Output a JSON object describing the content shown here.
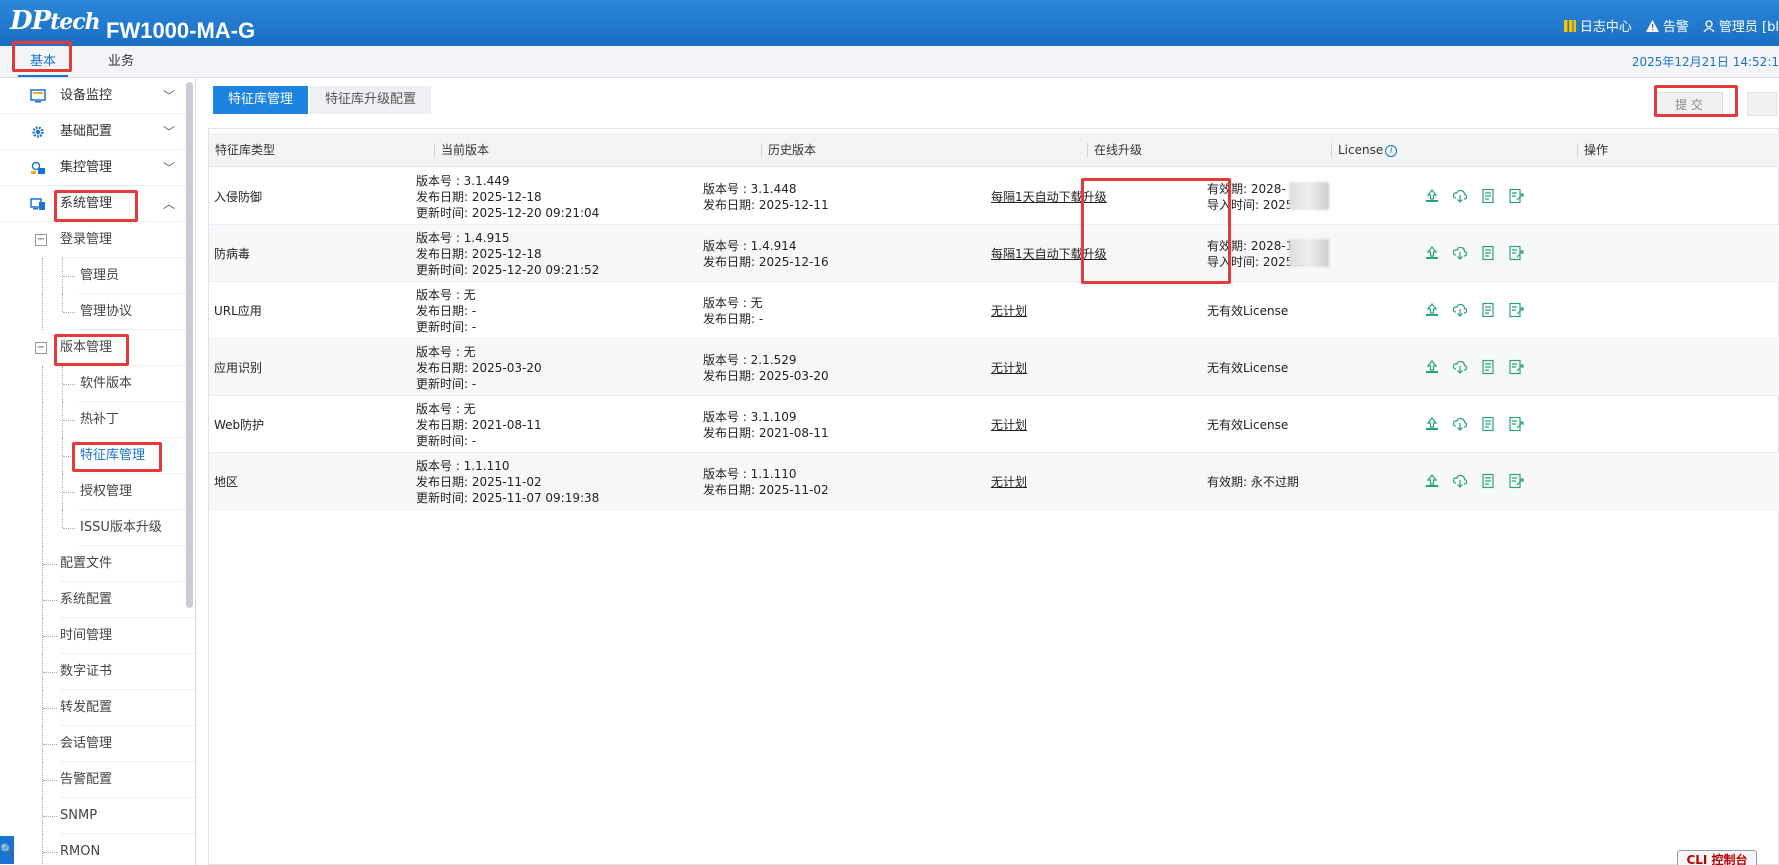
{
  "header": {
    "logo_main": "DP",
    "logo_sub": "tech",
    "model": "FW1000-MA-G",
    "log_center": "日志中心",
    "alarm": "告警",
    "user": "管理员 [bl"
  },
  "nav": {
    "tabs": [
      {
        "label": "基本"
      },
      {
        "label": "业务"
      }
    ],
    "datetime": "2025年12月21日   14:52:1"
  },
  "sidebar": {
    "groups": [
      {
        "label": "设备监控"
      },
      {
        "label": "基础配置"
      },
      {
        "label": "集控管理"
      },
      {
        "label": "系统管理"
      }
    ],
    "login_mgmt": "登录管理",
    "admin": "管理员",
    "mgmt_protocol": "管理协议",
    "version_mgmt": "版本管理",
    "software_version": "软件版本",
    "hotfix": "热补丁",
    "signature_mgmt": "特征库管理",
    "license_mgmt": "授权管理",
    "issu": "ISSU版本升级",
    "more": [
      {
        "label": "配置文件"
      },
      {
        "label": "系统配置"
      },
      {
        "label": "时间管理"
      },
      {
        "label": "数字证书"
      },
      {
        "label": "转发配置"
      },
      {
        "label": "会话管理"
      },
      {
        "label": "告警配置"
      },
      {
        "label": "SNMP"
      },
      {
        "label": "RMON"
      }
    ]
  },
  "content": {
    "tabs": [
      {
        "label": "特征库管理"
      },
      {
        "label": "特征库升级配置"
      }
    ],
    "submit": "提 交",
    "columns": {
      "type": "特征库类型",
      "current": "当前版本",
      "history": "历史版本",
      "online": "在线升级",
      "license": "License",
      "ops": "操作"
    },
    "rows": [
      {
        "type": "入侵防御",
        "cur_ver": "版本号 : 3.1.449",
        "cur_date": "发布日期:  2025-12-18",
        "cur_update": "更新时间:  2025-12-20 09:21:04",
        "hist_ver": "版本号 : 3.1.448",
        "hist_date": "发布日期:  2025-12-11",
        "online": "每隔1天自动下载升级",
        "lic1": "有效期:  2028-",
        "lic2": "导入时间:  2025-"
      },
      {
        "type": "防病毒",
        "cur_ver": "版本号 : 1.4.915",
        "cur_date": "发布日期:  2025-12-18",
        "cur_update": "更新时间:  2025-12-20 09:21:52",
        "hist_ver": "版本号 : 1.4.914",
        "hist_date": "发布日期:  2025-12-16",
        "online": "每隔1天自动下载升级",
        "lic1": "有效期:  2028-1",
        "lic2": "导入时间:  2025-1"
      },
      {
        "type": "URL应用",
        "cur_ver": "版本号 : 无",
        "cur_date": "发布日期:  -",
        "cur_update": "更新时间:  -",
        "hist_ver": "版本号 : 无",
        "hist_date": "发布日期:  -",
        "online": "无计划",
        "lic1": "无有效License",
        "lic2": ""
      },
      {
        "type": "应用识别",
        "cur_ver": "版本号 : 无",
        "cur_date": "发布日期:  2025-03-20",
        "cur_update": "更新时间:  -",
        "hist_ver": "版本号 : 2.1.529",
        "hist_date": "发布日期:  2025-03-20",
        "online": "无计划",
        "lic1": "无有效License",
        "lic2": ""
      },
      {
        "type": "Web防护",
        "cur_ver": "版本号 : 无",
        "cur_date": "发布日期:  2021-08-11",
        "cur_update": "更新时间:  -",
        "hist_ver": "版本号 : 3.1.109",
        "hist_date": "发布日期:  2021-08-11",
        "online": "无计划",
        "lic1": "无有效License",
        "lic2": ""
      },
      {
        "type": "地区",
        "cur_ver": "版本号 : 1.1.110",
        "cur_date": "发布日期:  2025-11-02",
        "cur_update": "更新时间:  2025-11-07 09:19:38",
        "hist_ver": "版本号 : 1.1.110",
        "hist_date": "发布日期:  2025-11-02",
        "online": "无计划",
        "lic1": "有效期:  永不过期",
        "lic2": ""
      }
    ]
  },
  "cli": "CLI 控制台",
  "colors": {
    "brand": "#1a73d0",
    "highlight": "#e33a3a",
    "op_icon": "#2aa37a"
  }
}
